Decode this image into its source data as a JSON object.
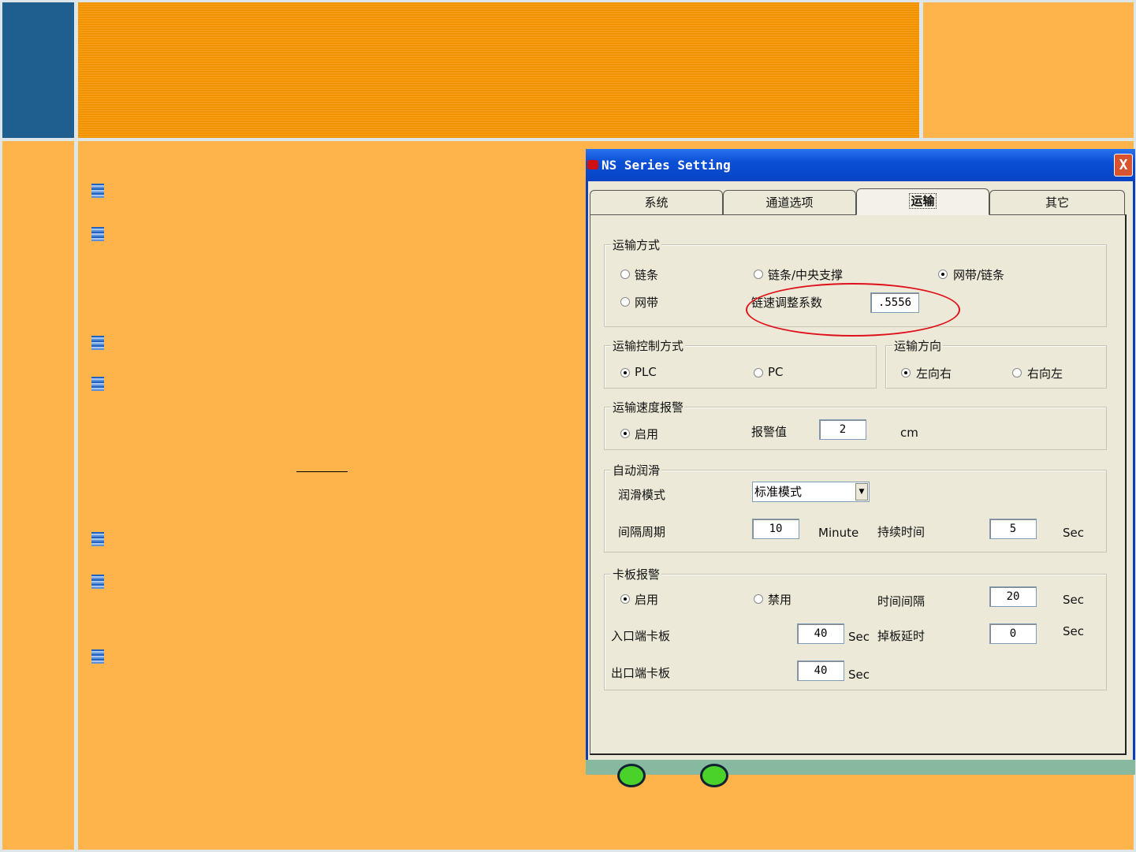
{
  "dialog": {
    "title": "NS Series Setting",
    "close": "X",
    "tabs": [
      "系统",
      "通道选项",
      "运输",
      "其它"
    ],
    "active_tab": "运输",
    "transport_mode": {
      "label": "运输方式",
      "options": [
        "链条",
        "链条/中央支撑",
        "网带/链条",
        "网带"
      ],
      "selected": "网带/链条",
      "coef_label": "链速调整系数",
      "coef_value": ".5556"
    },
    "control_mode": {
      "label": "运输控制方式",
      "options": [
        "PLC",
        "PC"
      ],
      "selected": "PLC"
    },
    "direction": {
      "label": "运输方向",
      "options": [
        "左向右",
        "右向左"
      ],
      "selected": "左向右"
    },
    "speed_alarm": {
      "label": "运输速度报警",
      "enable": "启用",
      "alarm_label": "报警值",
      "alarm_value": "2",
      "unit": "cm"
    },
    "lubrication": {
      "label": "自动润滑",
      "mode_label": "润滑模式",
      "mode_value": "标准模式",
      "interval_label": "间隔周期",
      "interval_value": "10",
      "interval_unit": "Minute",
      "duration_label": "持续时间",
      "duration_value": "5",
      "duration_unit": "Sec"
    },
    "jam_alarm": {
      "label": "卡板报警",
      "enable": "启用",
      "disable": "禁用",
      "selected": "启用",
      "time_label": "时间间隔",
      "time_value": "20",
      "time_unit": "Sec",
      "entry_label": "入口端卡板",
      "entry_value": "40",
      "entry_unit": "Sec",
      "drop_label": "掉板延时",
      "drop_value": "0",
      "drop_unit": "Sec",
      "exit_label": "出口端卡板",
      "exit_value": "40",
      "exit_unit": "Sec"
    }
  }
}
